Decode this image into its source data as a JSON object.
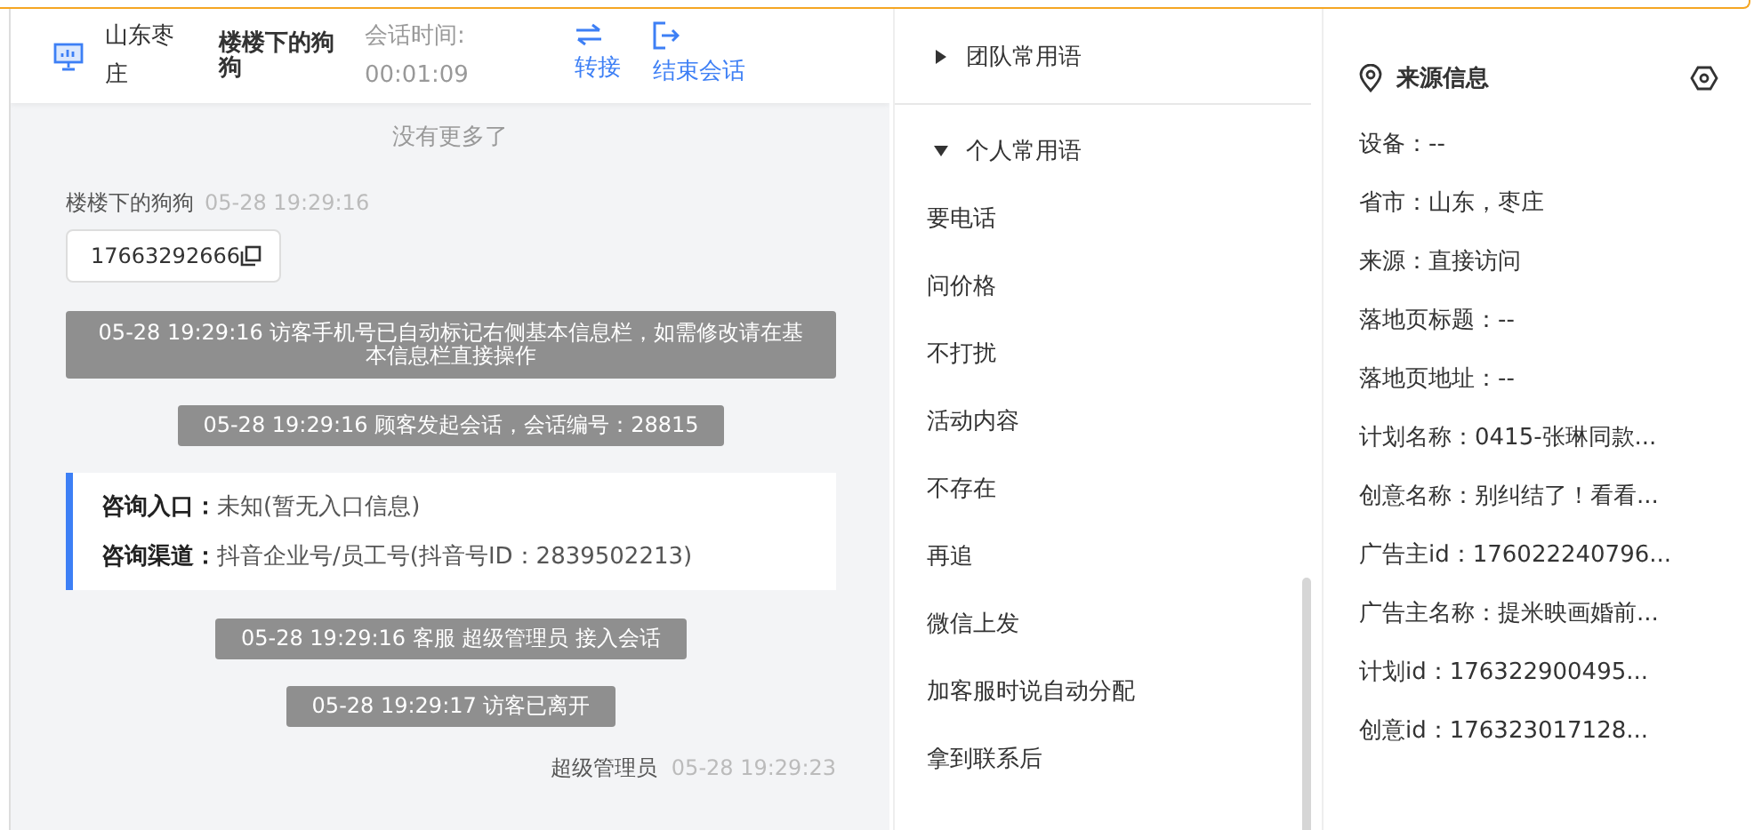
{
  "header": {
    "location": "山东枣庄",
    "visitor": "楼楼下的狗狗",
    "session_time_label": "会话时间:",
    "session_time": "00:01:09",
    "actions": [
      {
        "label": "转接",
        "kind": "transfer"
      },
      {
        "label": "结束会话",
        "kind": "end"
      }
    ]
  },
  "chat": {
    "no_more": "没有更多了",
    "messages": [
      {
        "kind": "visitor",
        "sender": "楼楼下的狗狗",
        "time": "05-28 19:29:16",
        "text": "17663292666"
      },
      {
        "kind": "system",
        "text": "05-28 19:29:16 访客手机号已自动标记右侧基本信息栏，如需修改请在基本信息栏直接操作"
      },
      {
        "kind": "system",
        "text": "05-28 19:29:16 顾客发起会话，会话编号：28815"
      },
      {
        "kind": "info",
        "rows": [
          {
            "label": "咨询入口：",
            "value": "未知(暂无入口信息)"
          },
          {
            "label": "咨询渠道：",
            "value": "抖音企业号/员工号(抖音号ID：2839502213)"
          }
        ]
      },
      {
        "kind": "system",
        "text": "05-28 19:29:16 客服 超级管理员 接入会话"
      },
      {
        "kind": "system",
        "text": "05-28 19:29:17 访客已离开"
      },
      {
        "kind": "agent",
        "sender": "超级管理员",
        "time": "05-28 19:29:23"
      }
    ]
  },
  "phrases": {
    "groups": [
      {
        "title": "团队常用语",
        "expanded": false
      },
      {
        "title": "个人常用语",
        "expanded": true,
        "items": [
          "要电话",
          "问价格",
          "不打扰",
          "活动内容",
          "不存在",
          "再追",
          "微信上发",
          "加客服时说自动分配",
          "拿到联系后"
        ]
      }
    ]
  },
  "source": {
    "title": "来源信息",
    "fields": [
      "设备：--",
      "省市：山东，枣庄",
      "来源：直接访问",
      "落地页标题：--",
      "落地页地址：--",
      "计划名称：0415-张琳同款...",
      "创意名称：别纠结了！看看...",
      "广告主id：176022240796...",
      "广告主名称：提米映画婚前...",
      "计划id：176322900495...",
      "创意id：176323017128..."
    ]
  }
}
